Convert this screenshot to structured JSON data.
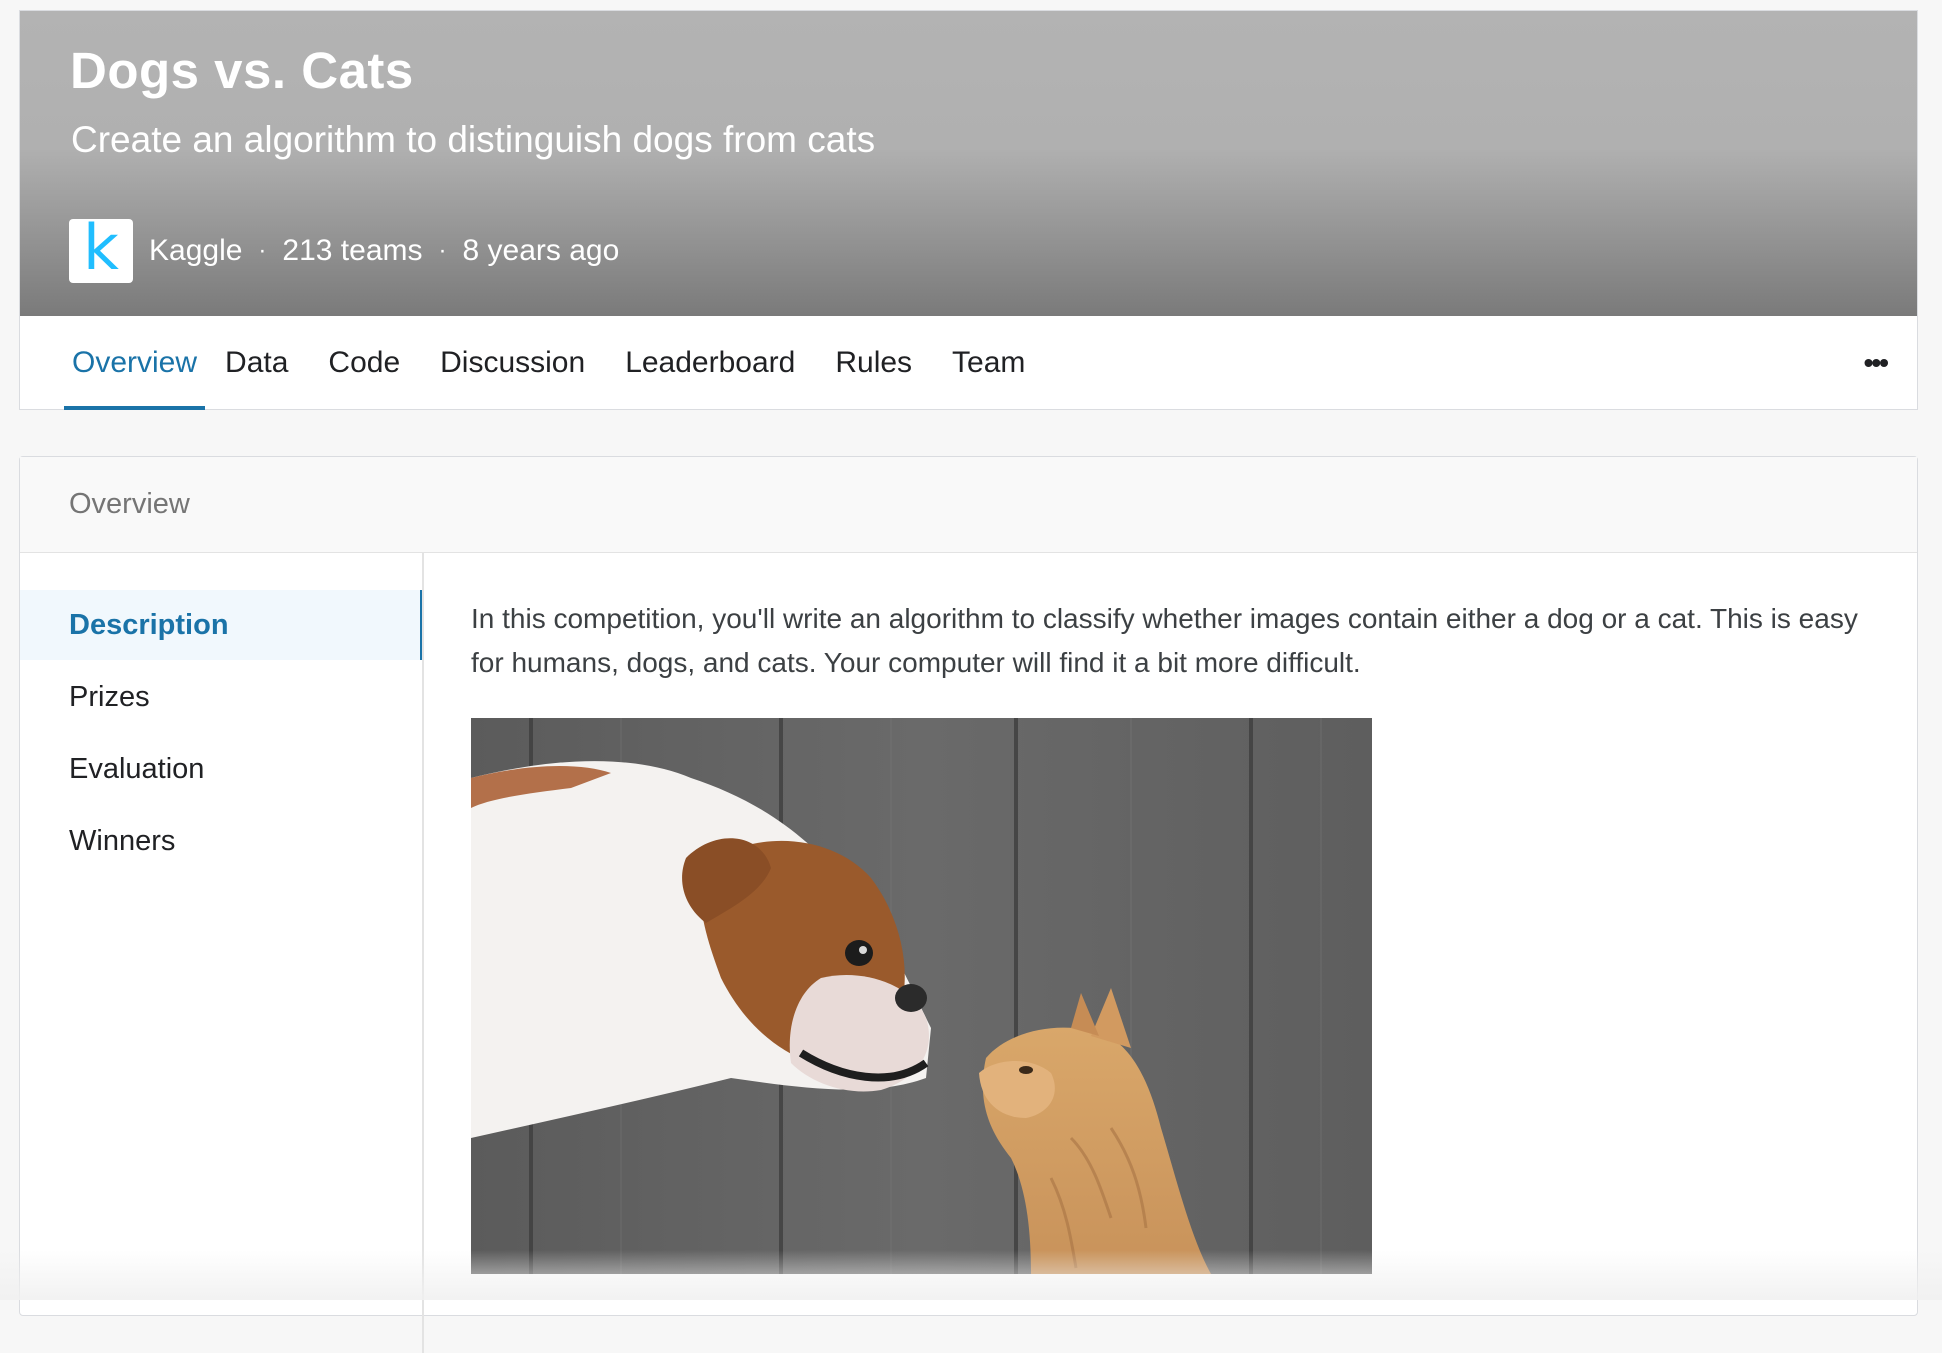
{
  "header": {
    "title": "Dogs vs. Cats",
    "subtitle": "Create an algorithm to distinguish dogs from cats",
    "host": "Kaggle",
    "teams": "213 teams",
    "age": "8 years ago",
    "logo_letter": "k",
    "separator": "·"
  },
  "tabs": [
    {
      "label": "Overview",
      "active": true
    },
    {
      "label": "Data",
      "active": false
    },
    {
      "label": "Code",
      "active": false
    },
    {
      "label": "Discussion",
      "active": false
    },
    {
      "label": "Leaderboard",
      "active": false
    },
    {
      "label": "Rules",
      "active": false
    },
    {
      "label": "Team",
      "active": false
    }
  ],
  "more_menu": {
    "label": "•••",
    "icon": "more-horizontal-icon"
  },
  "overview": {
    "heading": "Overview",
    "sidebar": [
      {
        "label": "Description",
        "active": true
      },
      {
        "label": "Prizes",
        "active": false
      },
      {
        "label": "Evaluation",
        "active": false
      },
      {
        "label": "Winners",
        "active": false
      }
    ],
    "description": "In this competition, you'll write an algorithm to classify whether images contain either a dog or a cat.  This is easy for humans, dogs, and cats. Your computer will find it a bit more difficult."
  },
  "colors": {
    "accent": "#1a73a8",
    "kaggle_blue": "#20beff",
    "banner": "#b0b0b0"
  }
}
